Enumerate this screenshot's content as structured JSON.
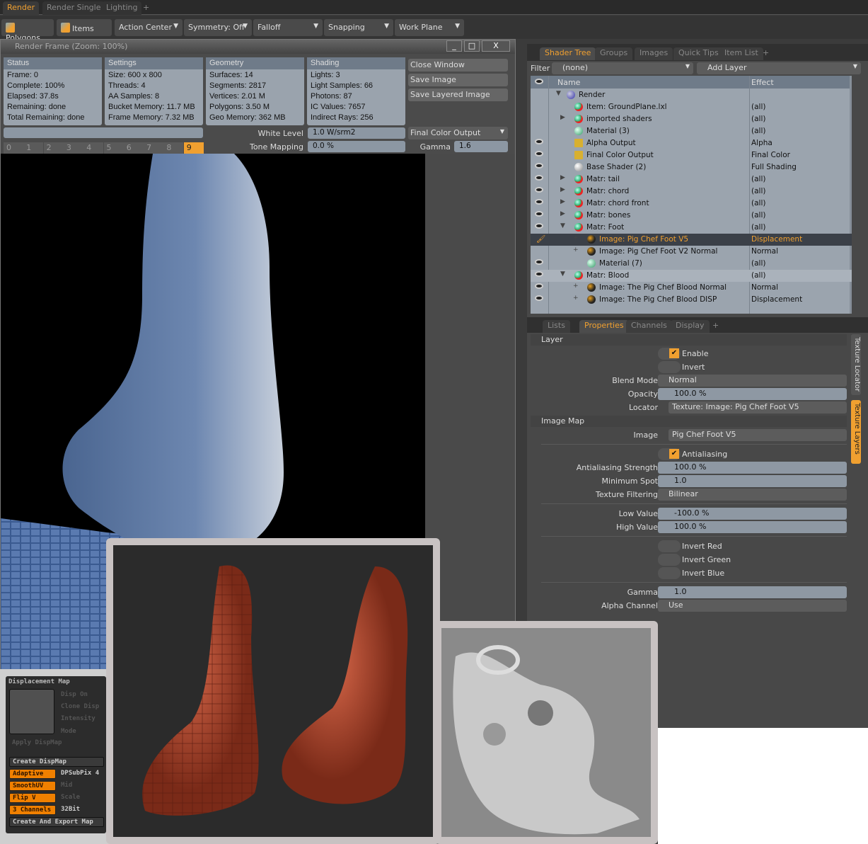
{
  "top_tabs": [
    "Render",
    "Render Single",
    "Lighting",
    "+"
  ],
  "toolbar": {
    "polygons": "Polygons",
    "items": "Items",
    "action_center": "Action Center",
    "symmetry": "Symmetry: Off",
    "falloff": "Falloff",
    "snapping": "Snapping",
    "work_plane": "Work Plane"
  },
  "render_frame": {
    "title": "Render Frame (Zoom: 100%)",
    "window_buttons": [
      "_",
      "□",
      "X"
    ],
    "panels": [
      {
        "header": "Status",
        "lines": [
          "Frame: 0",
          "Complete: 100%",
          "Elapsed: 37.8s",
          "Remaining: done",
          "Total Remaining: done"
        ]
      },
      {
        "header": "Settings",
        "lines": [
          "Size: 600 x 800",
          "Threads: 4",
          "AA Samples: 8",
          "Bucket Memory: 11.7 MB",
          "Frame Memory: 7.32 MB"
        ]
      },
      {
        "header": "Geometry",
        "lines": [
          "Surfaces: 14",
          "Segments: 2817",
          "Vertices: 2.01 M",
          "Polygons: 3.50 M",
          "Geo Memory: 362 MB"
        ]
      },
      {
        "header": "Shading",
        "lines": [
          "Lights: 3",
          "Light Samples: 66",
          "Photons: 87",
          "IC Values: 7657",
          "Indirect Rays: 256"
        ]
      }
    ],
    "close_window": "Close Window",
    "save_image": "Save Image",
    "save_layered": "Save Layered Image",
    "white_level_label": "White Level",
    "white_level": "1.0 W/srm2",
    "tone_mapping_label": "Tone Mapping",
    "tone_mapping": "0.0 %",
    "output": "Final Color Output",
    "gamma_label": "Gamma",
    "gamma": "1.6",
    "buffers": [
      "0",
      "1",
      "2",
      "3",
      "4",
      "5",
      "6",
      "7",
      "8",
      "9"
    ],
    "active_buffer": "9"
  },
  "shader_panel": {
    "tabs": [
      "Shader Tree",
      "Groups",
      "Images",
      "Quick Tips",
      "Item List",
      "+"
    ],
    "filter_label": "Filter",
    "filter_value": "(none)",
    "add_layer": "Add Layer",
    "col_name": "Name",
    "col_effect": "Effect",
    "rows": [
      {
        "name": "Render",
        "effect": "",
        "eye": false,
        "indent": 0,
        "arrow": "▼",
        "icon": "sphere-blue"
      },
      {
        "name": "Item: GroundPlane.lxl",
        "effect": "(all)",
        "eye": false,
        "indent": 1,
        "arrow": "",
        "icon": "material-red"
      },
      {
        "name": "imported shaders",
        "effect": "(all)",
        "eye": false,
        "indent": 1,
        "arrow": "▶",
        "icon": "material-red"
      },
      {
        "name": "Material (3)",
        "effect": "(all)",
        "eye": false,
        "indent": 1,
        "arrow": "",
        "icon": "material-green"
      },
      {
        "name": "Alpha Output",
        "effect": "Alpha",
        "eye": true,
        "indent": 1,
        "arrow": "",
        "icon": "output"
      },
      {
        "name": "Final Color Output",
        "effect": "Final Color",
        "eye": true,
        "indent": 1,
        "arrow": "",
        "icon": "output"
      },
      {
        "name": "Base Shader (2)",
        "effect": "Full Shading",
        "eye": true,
        "indent": 1,
        "arrow": "",
        "icon": "shader-white"
      },
      {
        "name": "Matr: tail",
        "effect": "(all)",
        "eye": true,
        "indent": 1,
        "arrow": "▶",
        "icon": "material-red"
      },
      {
        "name": "Matr: chord",
        "effect": "(all)",
        "eye": true,
        "indent": 1,
        "arrow": "▶",
        "icon": "material-red"
      },
      {
        "name": "Matr: chord front",
        "effect": "(all)",
        "eye": true,
        "indent": 1,
        "arrow": "▶",
        "icon": "material-red"
      },
      {
        "name": "Matr: bones",
        "effect": "(all)",
        "eye": true,
        "indent": 1,
        "arrow": "▶",
        "icon": "material-red"
      },
      {
        "name": "Matr: Foot",
        "effect": "(all)",
        "eye": true,
        "indent": 1,
        "arrow": "▼",
        "icon": "material-red"
      },
      {
        "name": "Image: Pig Chef Foot V5",
        "effect": "Displacement",
        "eye": false,
        "brush": true,
        "indent": 2,
        "arrow": "+",
        "icon": "image",
        "selected": true
      },
      {
        "name": "Image: Pig Chef Foot V2 Normal",
        "effect": "Normal",
        "eye": false,
        "indent": 2,
        "arrow": "+",
        "icon": "image"
      },
      {
        "name": "Material (7)",
        "effect": "(all)",
        "eye": true,
        "indent": 2,
        "arrow": "",
        "icon": "material-green"
      },
      {
        "name": "Matr: Blood",
        "effect": "(all)",
        "eye": true,
        "indent": 1,
        "arrow": "▼",
        "icon": "material-red",
        "highlight": true
      },
      {
        "name": "Image: The Pig Chef Blood Normal",
        "effect": "Normal",
        "eye": true,
        "indent": 2,
        "arrow": "+",
        "icon": "image"
      },
      {
        "name": "Image: The Pig Chef Blood DISP",
        "effect": "Displacement",
        "eye": true,
        "indent": 2,
        "arrow": "+",
        "icon": "image"
      }
    ]
  },
  "properties_panel": {
    "tabs": [
      "Lists",
      "Properties",
      "Channels",
      "Display",
      "+"
    ],
    "side_tabs": [
      "Texture Locator",
      "Texture Layers"
    ],
    "layer_section": "Layer",
    "image_map_section": "Image Map",
    "enable": "Enable",
    "invert": "Invert",
    "blend_mode_label": "Blend Mode",
    "blend_mode": "Normal",
    "opacity_label": "Opacity",
    "opacity": "100.0 %",
    "locator_label": "Locator",
    "locator": "Texture: Image: Pig Chef Foot V5",
    "image_label": "Image",
    "image": "Pig Chef Foot V5",
    "antialiasing": "Antialiasing",
    "aa_strength_label": "Antialiasing Strength",
    "aa_strength": "100.0 %",
    "min_spot_label": "Minimum Spot",
    "min_spot": "1.0",
    "tex_filter_label": "Texture Filtering",
    "tex_filter": "Bilinear",
    "low_label": "Low Value",
    "low": "-100.0 %",
    "high_label": "High Value",
    "high": "100.0 %",
    "invert_red": "Invert Red",
    "invert_green": "Invert Green",
    "invert_blue": "Invert Blue",
    "gamma_label": "Gamma",
    "gamma": "1.0",
    "alpha_label": "Alpha Channel",
    "alpha": "Use"
  },
  "zbrush": {
    "title": "Displacement Map",
    "disp_on": "Disp On",
    "clone_disp": "Clone Disp",
    "intensity": "Intensity",
    "mode": "Mode",
    "apply": "Apply DispMap",
    "create": "Create DispMap",
    "adaptive": "Adaptive",
    "dpsubpix": "DPSubPix 4",
    "smoothuv": "SmoothUV",
    "mid": "Mid",
    "flipv": "Flip V",
    "scale": "Scale",
    "channels": "3 Channels",
    "bits": "32Bit",
    "export": "Create And Export Map"
  },
  "colors": {
    "accent": "#f0a030",
    "panel": "#484848",
    "field": "#8e98a3"
  }
}
